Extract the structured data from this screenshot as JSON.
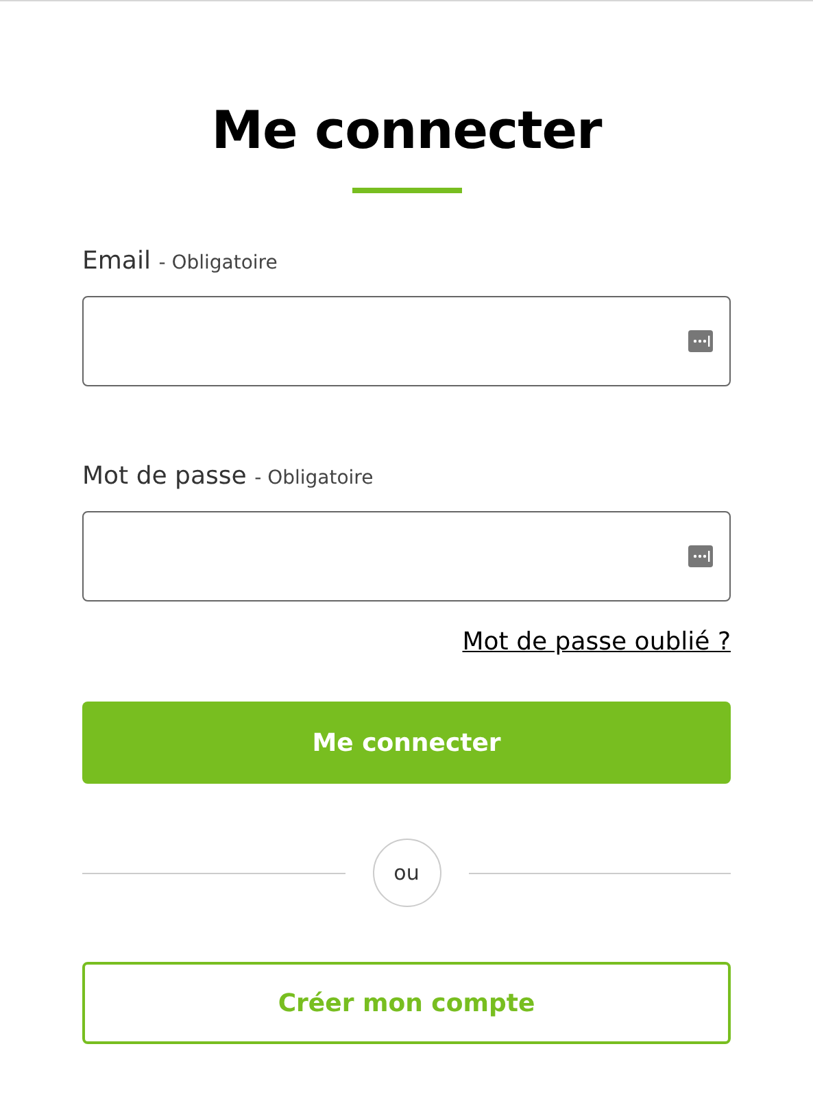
{
  "title": "Me connecter",
  "fields": [
    {
      "label": "Email",
      "note": "- Obligatoire"
    },
    {
      "label": "Mot de passe",
      "note": "- Obligatoire"
    }
  ],
  "forgot_link": "Mot de passe oublié ?",
  "submit_button": "Me connecter",
  "separator": "ou",
  "create_button": "Créer mon compte"
}
